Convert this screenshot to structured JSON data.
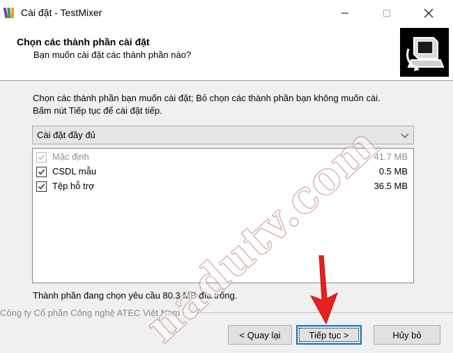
{
  "window": {
    "title": "Cài đặt - TestMixer",
    "controls": {
      "minimize": "minimize-icon",
      "maximize": "maximize-icon",
      "close": "close-icon"
    }
  },
  "header": {
    "title": "Chọn các thành phần cài đặt",
    "subtitle": "Bạn muốn cài đặt các thành phần nào?",
    "logo": "installer-computer-icon"
  },
  "description": {
    "line1": "Chọn các thành phần bạn muốn cài đặt; Bỏ chọn các thành phần bạn không muốn cài.",
    "line2": "Bấm nút Tiếp tục để cài đặt tiếp."
  },
  "install_type": {
    "selected": "Cài đặt đầy đủ"
  },
  "components": [
    {
      "label": "Mặc định",
      "size": "41.7 MB",
      "checked": true,
      "disabled": true
    },
    {
      "label": "CSDL mẫu",
      "size": "0.5 MB",
      "checked": true,
      "disabled": false
    },
    {
      "label": "Tệp hỗ trợ",
      "size": "36.5 MB",
      "checked": true,
      "disabled": false
    }
  ],
  "space_required": "Thành phần đang chọn yêu cầu 80.3 MB đĩa trống.",
  "company": "Công ty Cổ phần Công nghệ ATEC Việt Nam",
  "buttons": {
    "back": "< Quay lại",
    "next": "Tiếp tục >",
    "cancel": "Hủy bỏ"
  },
  "overlay": {
    "watermark": "nadutv.com",
    "arrow_color": "#e8201e"
  },
  "colors": {
    "focus": "#0078d7",
    "disabled_text": "#8f8f8f"
  }
}
